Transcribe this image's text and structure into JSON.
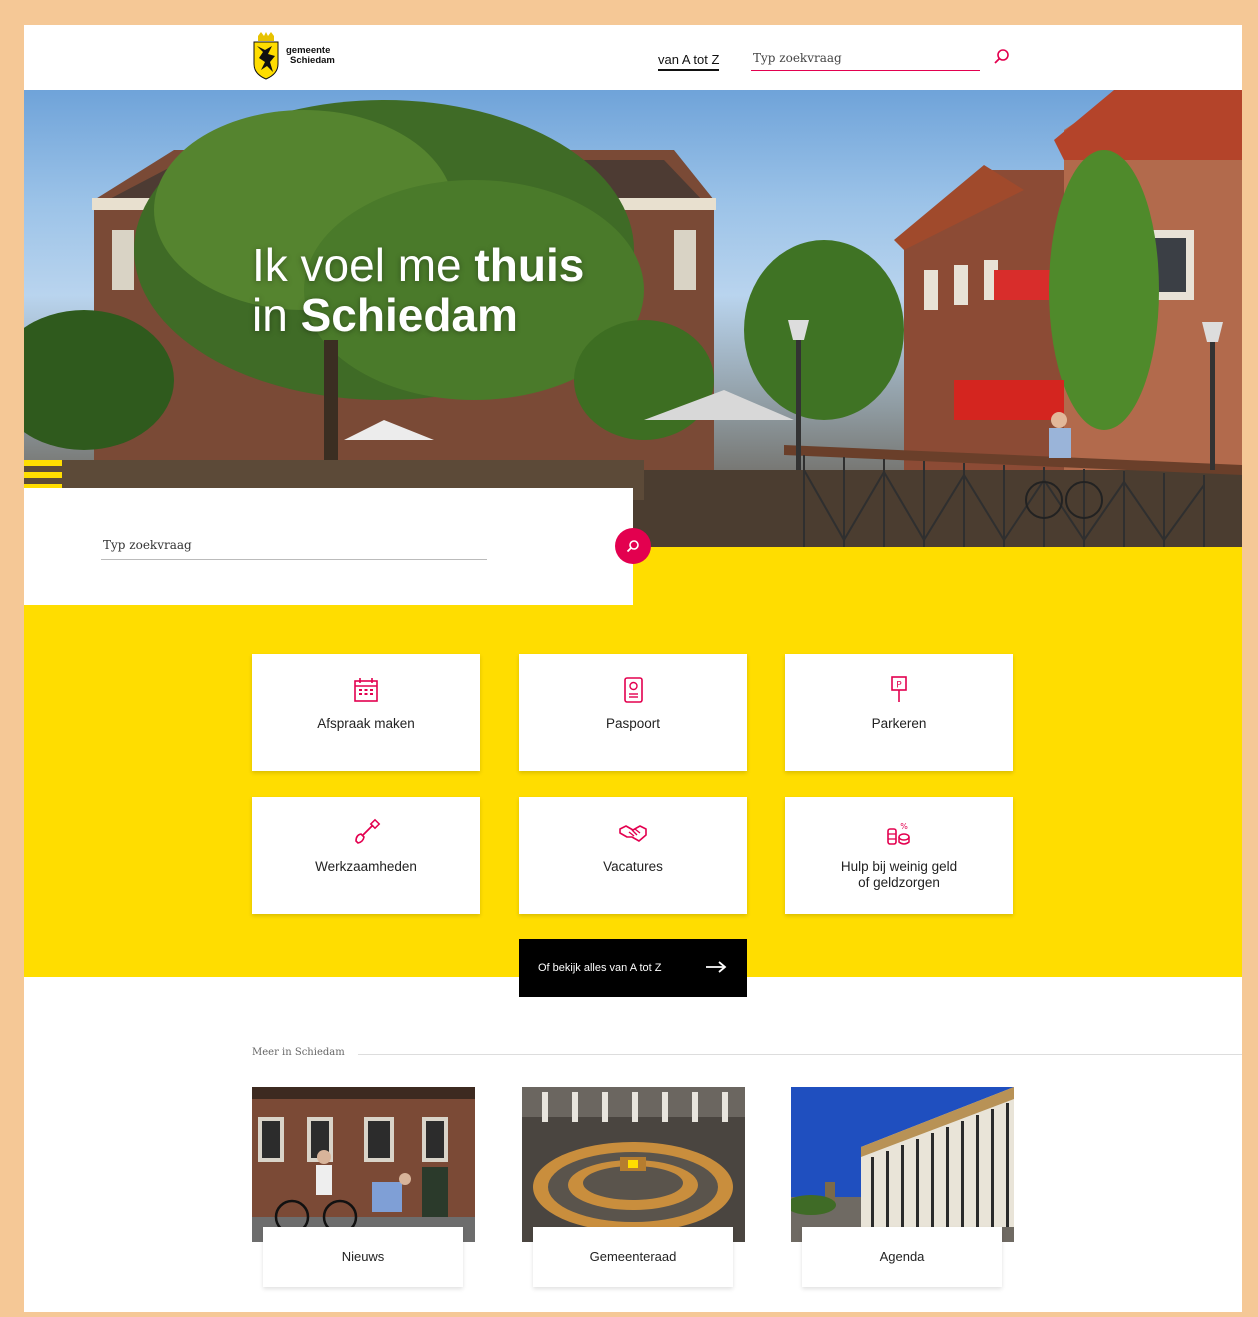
{
  "header": {
    "logo_line1": "gemeente",
    "logo_line2": "Schiedam",
    "nav_az": "van A tot Z",
    "search_placeholder": "Typ zoekvraag"
  },
  "hero": {
    "title_line1_light": "Ik voel me ",
    "title_line1_bold": "thuis",
    "title_line2_light": "in ",
    "title_line2_bold": "Schiedam"
  },
  "search": {
    "placeholder": "Typ zoekvraag"
  },
  "tiles": [
    {
      "label": "Afspraak maken",
      "icon": "calendar-icon"
    },
    {
      "label": "Paspoort",
      "icon": "passport-icon"
    },
    {
      "label": "Parkeren",
      "icon": "parking-sign-icon"
    },
    {
      "label": "Werkzaamheden",
      "icon": "shovel-icon"
    },
    {
      "label": "Vacatures",
      "icon": "handshake-icon"
    },
    {
      "label": "Hulp bij weinig geld of geldzorgen",
      "icon": "coins-icon"
    }
  ],
  "az_button": {
    "label": "Of bekijk alles van A tot Z"
  },
  "more": {
    "label": "Meer in Schiedam",
    "cards": [
      {
        "label": "Nieuws"
      },
      {
        "label": "Gemeenteraad"
      },
      {
        "label": "Agenda"
      }
    ]
  },
  "colors": {
    "accent": "#e3004f",
    "yellow": "#ffdd00",
    "frame": "#f5c896"
  }
}
